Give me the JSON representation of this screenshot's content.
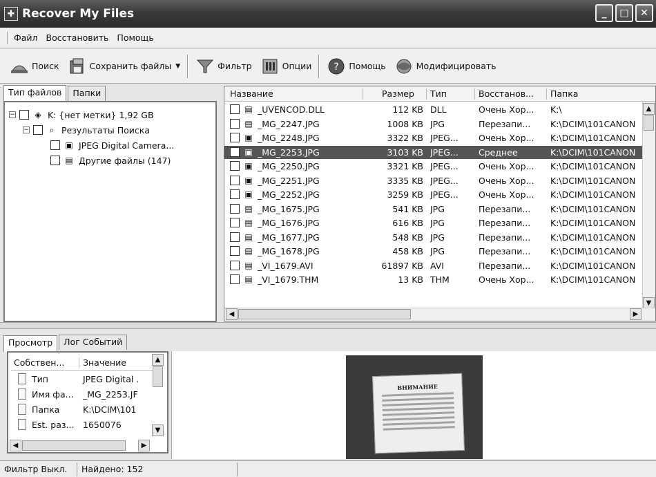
{
  "window": {
    "title": "Recover My Files"
  },
  "menu": {
    "items": [
      "Файл",
      "Восстановить",
      "Помощь"
    ]
  },
  "toolbar": {
    "search_label": "Поиск",
    "save_label": "Сохранить файлы",
    "filter_label": "Фильтр",
    "options_label": "Опции",
    "help_label": "Помощь",
    "upgrade_label": "Модифицировать"
  },
  "left_tabs": [
    "Тип файлов",
    "Папки"
  ],
  "tree": [
    {
      "label": "K: {нет метки} 1,92 GB"
    },
    {
      "label": "Результаты Поиска"
    },
    {
      "label": "JPEG Digital Camera..."
    },
    {
      "label": "Другие файлы (147)"
    }
  ],
  "file_list": {
    "headers": [
      "Название",
      "Размер",
      "Тип",
      "Восстанов...",
      "Папка"
    ],
    "rows": [
      {
        "name": "_UVENCOD.DLL",
        "size": "112 KB",
        "type": "DLL",
        "recovery": "Очень Хор...",
        "folder": "K:\\",
        "icon": "generic-file-icon"
      },
      {
        "name": "_MG_2247.JPG",
        "size": "1008 KB",
        "type": "JPG",
        "recovery": "Перезапи...",
        "folder": "K:\\DCIM\\101CANON",
        "icon": "generic-file-icon"
      },
      {
        "name": "_MG_2248.JPG",
        "size": "3322 KB",
        "type": "JPEG...",
        "recovery": "Очень Хор...",
        "folder": "K:\\DCIM\\101CANON",
        "icon": "camera-file-icon"
      },
      {
        "name": "_MG_2253.JPG",
        "size": "3103 KB",
        "type": "JPEG...",
        "recovery": "Среднее",
        "folder": "K:\\DCIM\\101CANON",
        "icon": "camera-file-icon",
        "selected": true
      },
      {
        "name": "_MG_2250.JPG",
        "size": "3321 KB",
        "type": "JPEG...",
        "recovery": "Очень Хор...",
        "folder": "K:\\DCIM\\101CANON",
        "icon": "camera-file-icon"
      },
      {
        "name": "_MG_2251.JPG",
        "size": "3335 KB",
        "type": "JPEG...",
        "recovery": "Очень Хор...",
        "folder": "K:\\DCIM\\101CANON",
        "icon": "camera-file-icon"
      },
      {
        "name": "_MG_2252.JPG",
        "size": "3259 KB",
        "type": "JPEG...",
        "recovery": "Очень Хор...",
        "folder": "K:\\DCIM\\101CANON",
        "icon": "camera-file-icon"
      },
      {
        "name": "_MG_1675.JPG",
        "size": "541 KB",
        "type": "JPG",
        "recovery": "Перезапи...",
        "folder": "K:\\DCIM\\101CANON",
        "icon": "generic-file-icon"
      },
      {
        "name": "_MG_1676.JPG",
        "size": "616 KB",
        "type": "JPG",
        "recovery": "Перезапи...",
        "folder": "K:\\DCIM\\101CANON",
        "icon": "generic-file-icon"
      },
      {
        "name": "_MG_1677.JPG",
        "size": "548 KB",
        "type": "JPG",
        "recovery": "Перезапи...",
        "folder": "K:\\DCIM\\101CANON",
        "icon": "generic-file-icon"
      },
      {
        "name": "_MG_1678.JPG",
        "size": "458 KB",
        "type": "JPG",
        "recovery": "Перезапи...",
        "folder": "K:\\DCIM\\101CANON",
        "icon": "generic-file-icon"
      },
      {
        "name": "_VI_1679.AVI",
        "size": "61897 KB",
        "type": "AVI",
        "recovery": "Перезапи...",
        "folder": "K:\\DCIM\\101CANON",
        "icon": "generic-file-icon"
      },
      {
        "name": "_VI_1679.THM",
        "size": "13 KB",
        "type": "THM",
        "recovery": "Очень Хор...",
        "folder": "K:\\DCIM\\101CANON",
        "icon": "generic-file-icon"
      }
    ]
  },
  "bottom_tabs": [
    "Просмотр",
    "Лог Событий"
  ],
  "properties": {
    "headers": [
      "Собствен...",
      "Значение"
    ],
    "rows": [
      {
        "name": "Тип",
        "value": "JPEG Digital ."
      },
      {
        "name": "Имя фа...",
        "value": "_MG_2253.JF"
      },
      {
        "name": "Папка",
        "value": "K:\\DCIM\\101"
      },
      {
        "name": "Est. раз...",
        "value": "1650076"
      }
    ]
  },
  "preview": {
    "heading": "ВНИМАНИЕ"
  },
  "status": {
    "filter": "Фильтр Выкл.",
    "found": "Найдено: 152"
  }
}
